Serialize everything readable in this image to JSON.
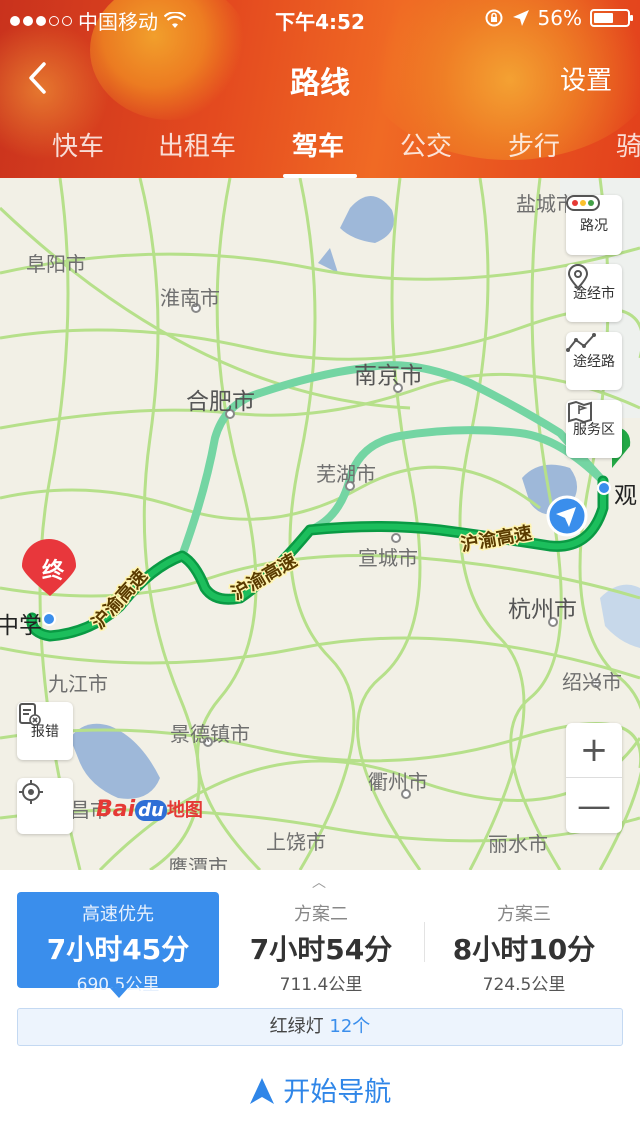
{
  "status_bar": {
    "carrier": "中国移动",
    "time": "下午4:52",
    "battery": "56%"
  },
  "navbar": {
    "back_icon": "chevron-left-icon",
    "title": "路线",
    "settings": "设置"
  },
  "tabs": [
    "快车",
    "出租车",
    "驾车",
    "公交",
    "步行",
    "骑"
  ],
  "active_tab": "驾车",
  "map": {
    "cities": {
      "yancheng": "盐城市",
      "fuyang": "阜阳市",
      "huainan": "淮南市",
      "hefei": "合肥市",
      "nanjing": "南京市",
      "wuhu": "芜湖市",
      "xuancheng": "宣城市",
      "hangzhou": "杭州市",
      "shaoxing": "绍兴市",
      "jiujiang": "九江市",
      "jingdezhen": "景德镇市",
      "quzhou": "衢州市",
      "shangrao": "上饶市",
      "lishui": "丽水市",
      "yingtan": "鹰潭市",
      "nanchang_partial": "昌市",
      "origin_partial": "观",
      "dest_partial": "中学"
    },
    "road_labels": [
      "沪渝高速",
      "沪渝高速",
      "沪渝高速"
    ],
    "end_marker": "终",
    "controls": {
      "traffic": "路况",
      "via_city": "途经市",
      "via_road": "途经路",
      "service_area": "服务区",
      "report": "报错",
      "zoom_in": "+",
      "zoom_out": "—"
    },
    "logo": {
      "bai": "Bai",
      "du": "du",
      "text": "地图"
    }
  },
  "plans": [
    {
      "label": "高速优先",
      "time": "7小时45分",
      "distance": "690.5公里"
    },
    {
      "label": "方案二",
      "time": "7小时54分",
      "distance": "711.4公里"
    },
    {
      "label": "方案三",
      "time": "8小时10分",
      "distance": "724.5公里"
    }
  ],
  "traffic_lights": {
    "label": "红绿灯",
    "count": "12个"
  },
  "start_navigation": "开始导航",
  "colors": {
    "header_red": "#e44a1f",
    "accent_blue": "#3a8eec",
    "route_green": "#0fa84a",
    "alt_route": "#6fd3a0",
    "end_marker_red": "#e8373c"
  }
}
